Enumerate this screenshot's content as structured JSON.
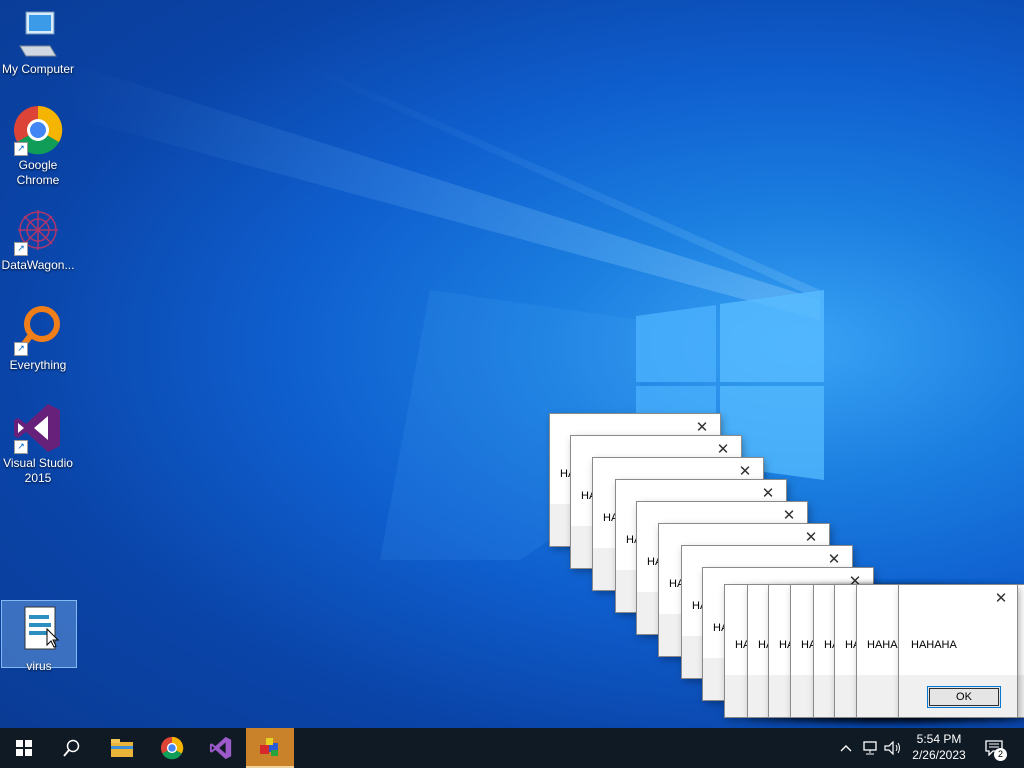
{
  "desktop_icons": [
    {
      "label": "My Computer",
      "icon": "computer-icon"
    },
    {
      "label": "Google\nChrome",
      "icon": "chrome-icon"
    },
    {
      "label": "DataWagon...",
      "icon": "datawagon-icon"
    },
    {
      "label": "Everything",
      "icon": "everything-search-icon"
    },
    {
      "label": "Visual Studio\n2015",
      "icon": "visual-studio-icon"
    },
    {
      "label": "virus",
      "icon": "script-file-icon"
    }
  ],
  "dialogs": {
    "message": "HAHAHA",
    "ok_label": "OK",
    "close_glyph": "✕"
  },
  "taskbar": {
    "items": [
      "start-icon",
      "search-icon",
      "file-explorer-icon",
      "chrome-icon",
      "visual-studio-icon",
      "app-icon"
    ],
    "tray": {
      "time": "5:54 PM",
      "date": "2/26/2023",
      "notifications": "2"
    }
  },
  "colors": {
    "taskbar": "#101a24",
    "accent": "#0078d7",
    "active_task": "#c9812a"
  }
}
